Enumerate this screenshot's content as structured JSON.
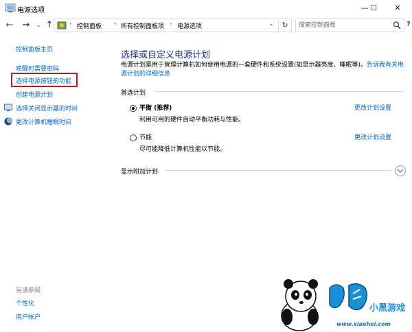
{
  "window": {
    "title": "电源选项",
    "minimize": "—",
    "maximize": "☐",
    "close": "✕"
  },
  "nav": {
    "back": "←",
    "forward": "→",
    "recent": "⌄",
    "up": "↑"
  },
  "address": {
    "breadcrumb": [
      "控制面板",
      "所有控制面板项",
      "电源选项"
    ],
    "separator": "›",
    "dropdown": "⌄",
    "refresh": "↻"
  },
  "search": {
    "placeholder": "搜索控制面板"
  },
  "help_label": "?",
  "sidebar": {
    "home": "控制面板主页",
    "items": [
      {
        "label": "唤醒时需要密码"
      },
      {
        "label": "选择电源按钮的功能"
      },
      {
        "label": "创建电源计划"
      },
      {
        "label": "选择关闭显示器的时间",
        "icon": "monitor-icon"
      },
      {
        "label": "更改计算机睡眠时间",
        "icon": "moon-icon"
      }
    ],
    "see_also": {
      "title": "另请参阅",
      "links": [
        "个性化",
        "用户帐户"
      ]
    }
  },
  "main": {
    "title": "选择或自定义电源计划",
    "description": "电源计划是用于管理计算机如何使用电源的一套硬件和系统设置(如显示器亮度、睡眠等)。",
    "description_link": "告诉我有关电源计划的详细信息",
    "preferred_label": "首选计划",
    "plans": [
      {
        "name": "平衡 (推荐)",
        "description": "利用可用的硬件自动平衡功耗与性能。",
        "link": "更改计划设置",
        "selected": true
      },
      {
        "name": "节能",
        "description": "尽可能降低计算机性能以节能。",
        "link": "更改计划设置",
        "selected": false
      }
    ],
    "additional_label": "显示附加计划"
  },
  "watermark": {
    "brand": "小黑游戏",
    "url": "www.xiaohei.com"
  },
  "colors": {
    "link": "#0066cc",
    "title": "#1e3287",
    "highlight": "#c4151c"
  }
}
